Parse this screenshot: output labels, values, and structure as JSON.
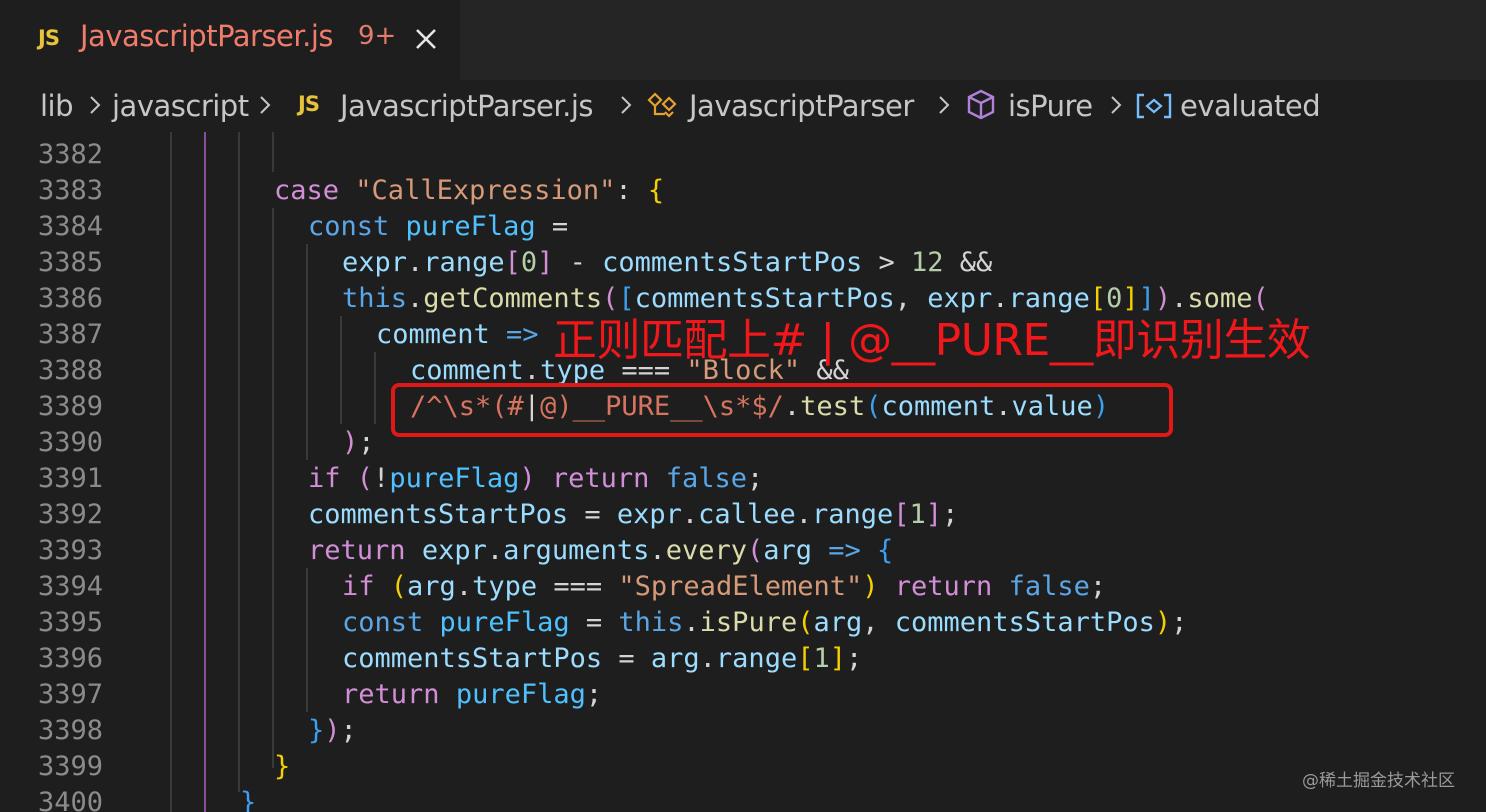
{
  "tab": {
    "icon_label": "JS",
    "title": "JavascriptParser.js",
    "problems_badge": "9+",
    "close_icon": "close-icon"
  },
  "breadcrumb": {
    "items": [
      "lib",
      "javascript",
      "JavascriptParser.js",
      "JavascriptParser",
      "isPure",
      "evaluated"
    ],
    "icons": {
      "file": "js-file-icon",
      "class": "class-icon",
      "method": "method-cube-icon",
      "variable": "variable-icon"
    },
    "separator": "chevron-right-icon"
  },
  "editor": {
    "line_numbers": [
      "3382",
      "3383",
      "3384",
      "3385",
      "3386",
      "3387",
      "3388",
      "3389",
      "3390",
      "3391",
      "3392",
      "3393",
      "3394",
      "3395",
      "3396",
      "3397",
      "3398",
      "3399",
      "3400"
    ],
    "lines": [
      "",
      "case \"CallExpression\": {",
      "  const pureFlag =",
      "    expr.range[0] - commentsStartPos > 12 &&",
      "    this.getComments([commentsStartPos, expr.range[0]]).some(",
      "      comment =>",
      "        comment.type === \"Block\" &&",
      "        /^\\s*(#|@)__PURE__\\s*$/.test(comment.value)",
      "    );",
      "  if (!pureFlag) return false;",
      "  commentsStartPos = expr.callee.range[1];",
      "  return expr.arguments.every(arg => {",
      "    if (arg.type === \"SpreadElement\") return false;",
      "    const pureFlag = this.isPure(arg, commentsStartPos);",
      "    commentsStartPos = arg.range[1];",
      "    return pureFlag;",
      "  });",
      "}",
      "}"
    ]
  },
  "annotation": {
    "text": "正则匹配上# | @__PURE__即识别生效"
  },
  "watermark": "@稀土掘金技术社区",
  "colors": {
    "background": "#1e1e1e",
    "tab_title": "#f07c6c",
    "annotation": "#f2171a",
    "keyword": "#d28ed7",
    "string": "#d69a78",
    "function": "#dcdcaa",
    "variable": "#9cdcfe"
  }
}
